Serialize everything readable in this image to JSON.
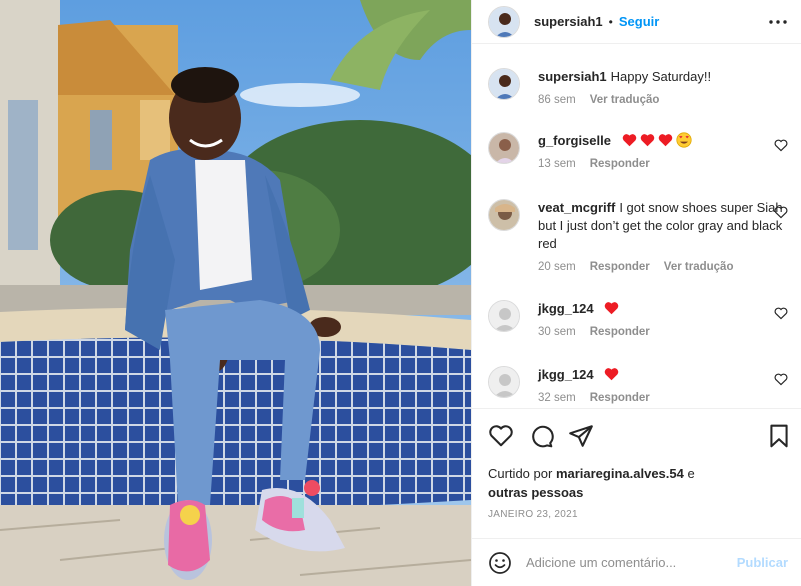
{
  "post": {
    "author": "supersiah1",
    "separator": "•",
    "follow_label": "Seguir",
    "more_icon": "more-options-icon"
  },
  "caption": {
    "username": "supersiah1",
    "text": "Happy Saturday!!",
    "age": "86 sem",
    "translate_label": "Ver tradução"
  },
  "comments": [
    {
      "username": "g_forgiselle",
      "text": "",
      "emoji": [
        "red-heart",
        "red-heart",
        "red-heart",
        "heart-eyes-face"
      ],
      "age": "13 sem",
      "reply_label": "Responder"
    },
    {
      "username": "veat_mcgriff",
      "text": "I got snow shoes super Siah but I just don’t get the color gray and black red",
      "age": "20 sem",
      "reply_label": "Responder",
      "translate_label": "Ver tradução"
    },
    {
      "username": "jkgg_124",
      "text": "",
      "emoji": [
        "red-heart"
      ],
      "age": "30 sem",
      "reply_label": "Responder"
    },
    {
      "username": "jkgg_124",
      "text": "",
      "emoji": [
        "red-heart"
      ],
      "age": "32 sem",
      "reply_label": "Responder"
    }
  ],
  "likes": {
    "prefix": "Curtido por",
    "user": "mariaregina.alves.54",
    "suffix": "e",
    "others": "outras pessoas"
  },
  "date": "JANEIRO 23, 2021",
  "add_comment": {
    "placeholder": "Adicione um comentário...",
    "publish_label": "Publicar"
  },
  "colors": {
    "accent": "#0095f6",
    "publish_disabled": "#b3dbff",
    "heart": "#ed4956",
    "muted": "#8e8e8e"
  }
}
